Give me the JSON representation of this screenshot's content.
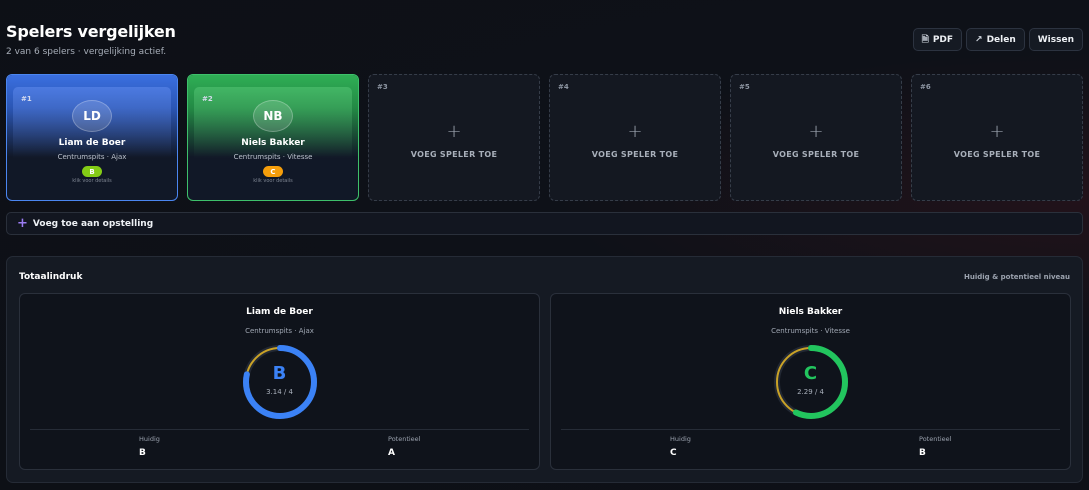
{
  "header": {
    "title": "Spelers vergelijken",
    "subtitle": "2 van 6 spelers · vergelijking actief.",
    "buttons": {
      "pdf": "PDF",
      "share": "Delen",
      "clear": "Wissen"
    }
  },
  "slots": [
    {
      "num": "#1",
      "initials": "LD",
      "name": "Liam de Boer",
      "meta": "Centrumspits · Ajax",
      "grade": "B",
      "grade_color": "#84cc16",
      "hint": "klik voor details",
      "accent": "#4b86f0"
    },
    {
      "num": "#2",
      "initials": "NB",
      "name": "Niels Bakker",
      "meta": "Centrumspits · Vitesse",
      "grade": "C",
      "grade_color": "#f59e0b",
      "hint": "klik voor details",
      "accent": "#3ec06b"
    },
    {
      "num": "#3",
      "add_label": "VOEG SPELER TOE"
    },
    {
      "num": "#4",
      "add_label": "VOEG SPELER TOE"
    },
    {
      "num": "#5",
      "add_label": "VOEG SPELER TOE"
    },
    {
      "num": "#6",
      "add_label": "VOEG SPELER TOE"
    }
  ],
  "lineup_button": "Voeg toe aan opstelling",
  "overview": {
    "title": "Totaalindruk",
    "subtitle": "Huidig & potentieel niveau",
    "current_label": "Huidig",
    "potential_label": "Potentieel",
    "cards": [
      {
        "name": "Liam de Boer",
        "meta": "Centrumspits · Ajax",
        "grade": "B",
        "score": "3.14 / 4",
        "score_fraction": 0.785,
        "color": "#3b82f6",
        "current": "B",
        "potential": "A"
      },
      {
        "name": "Niels Bakker",
        "meta": "Centrumspits · Vitesse",
        "grade": "C",
        "score": "2.29 / 4",
        "score_fraction": 0.5725,
        "color": "#22c55e",
        "current": "C",
        "potential": "B"
      }
    ],
    "potential_arc_color": "#c9a227"
  }
}
